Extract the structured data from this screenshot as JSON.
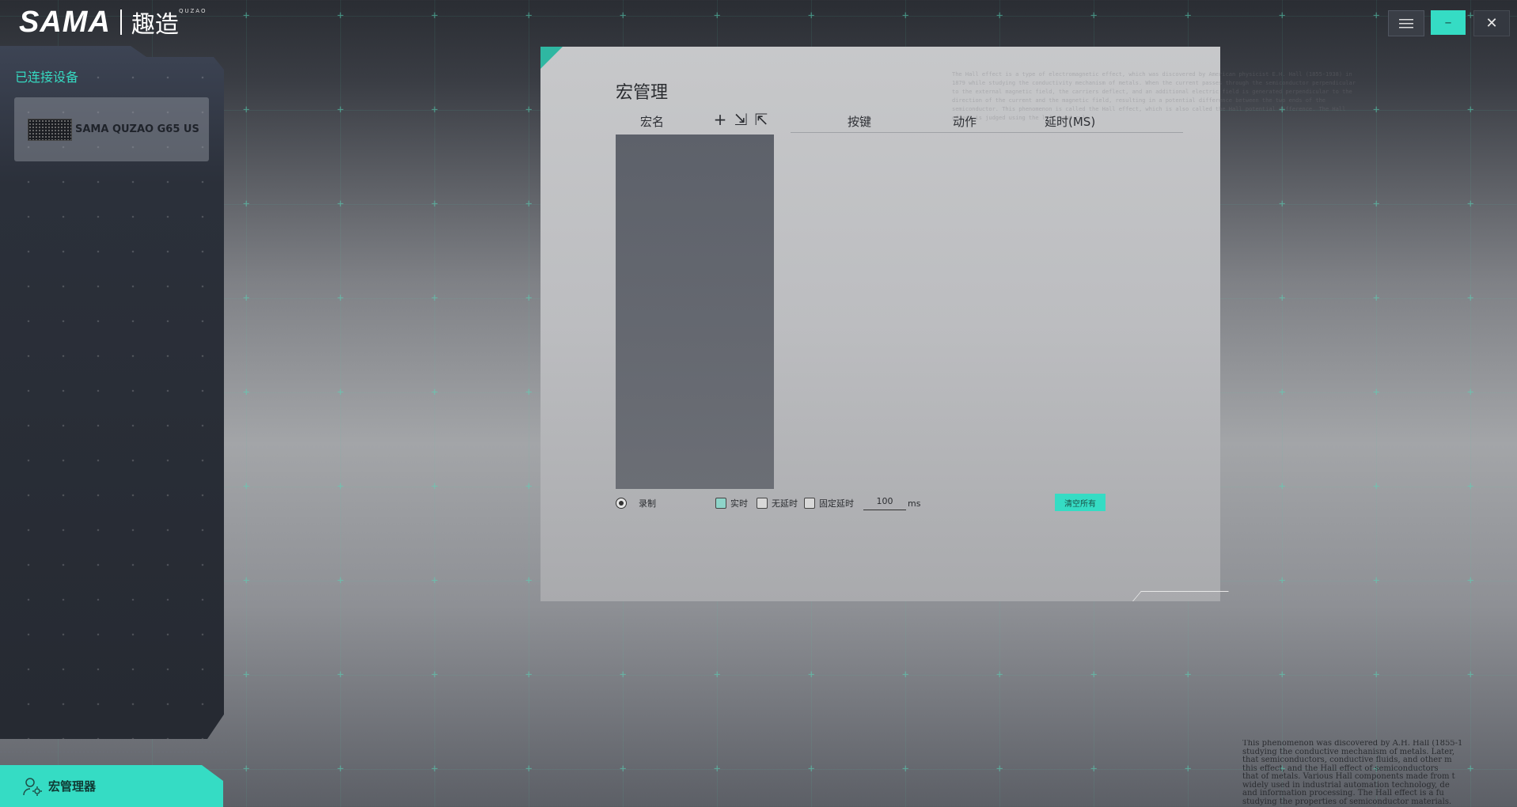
{
  "app": {
    "logo_text": "SAMA",
    "logo_cn": "趣造",
    "logo_sub": "QUZAO"
  },
  "window_controls": {
    "menu_icon": "hamburger-icon",
    "minimize_label": "–",
    "close_label": "✕"
  },
  "sidebar": {
    "title": "已连接设备",
    "device": {
      "name": "SAMA QUZAO G65 US",
      "icon": "keyboard-icon"
    },
    "bottom_tab": {
      "label": "宏管理器",
      "icon": "user-gear-icon"
    }
  },
  "panel": {
    "title": "宏管理",
    "columns": {
      "name": "宏名",
      "key": "按键",
      "action": "动作",
      "delay": "延时(MS)"
    },
    "toolbar": {
      "add": "+",
      "import": "⇲",
      "export": "⇱"
    },
    "options": {
      "record_label": "录制",
      "realtime_label": "实时",
      "nodelay_label": "无延时",
      "fixed_label": "固定延时",
      "fixed_value": "100",
      "unit": "ms",
      "clear_label": "清空所有"
    },
    "bg_text": "The Hall effect is a type of electromagnetic effect, which was discovered by American physicist E.H. Hall (1855-1938) in 1879 while studying the conductivity mechanism of metals. When the current passes through the semiconductor perpendicular to the external magnetic field, the carriers deflect, and an additional electric field is generated perpendicular to the direction of the current and the magnetic field, resulting in a potential difference between the two ends of the semiconductor. This phenomenon is called the Hall effect, which is also called the Hall potential difference. The Hall effect is judged using the left-hand rule."
  },
  "corner_text": [
    "This phenomenon was discovered by A.H. Hall (1855-1",
    "studying the conductive mechanism of metals. Later,",
    "that semiconductors, conductive fluids, and other m",
    "this effect, and the Hall effect of semiconductors",
    "that of metals. Various Hall components made from t",
    "widely used in industrial automation technology, de",
    "and information processing. The Hall effect is a fu",
    "studying the properties of semiconductor materials."
  ],
  "colors": {
    "accent": "#35dcc4",
    "panel_bg": "#c0c1c4",
    "sidebar_bg": "#2b303a"
  }
}
